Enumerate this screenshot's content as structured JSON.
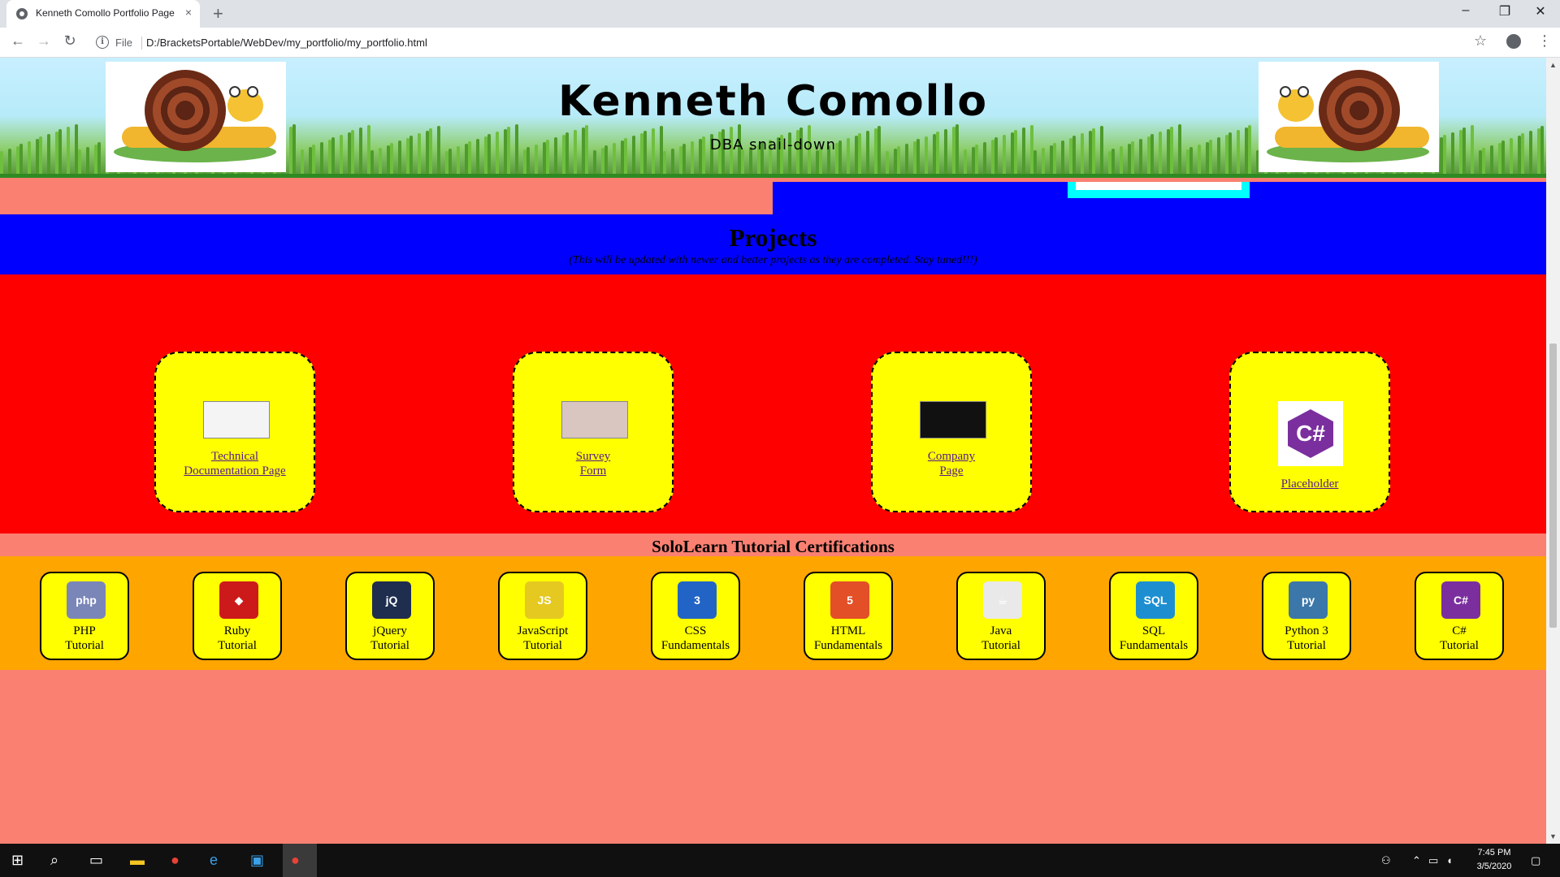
{
  "browser": {
    "tab_title": "Kenneth Comollo Portfolio Page",
    "new_tab": "+",
    "close_tab": "×",
    "minimize": "–",
    "restore": "❐",
    "close_window": "✕",
    "back": "←",
    "forward": "→",
    "reload": "↻",
    "info_icon": "i",
    "scheme_label": "File",
    "url": "D:/BracketsPortable/WebDev/my_portfolio/my_portfolio.html",
    "star": "☆",
    "menu": "⋮"
  },
  "header": {
    "name": "Kenneth Comollo",
    "tagline": "DBA snail-down"
  },
  "projects": {
    "title": "Projects",
    "subtitle": "(This will be updated with newer and better projects as they are completed. Stay tuned!!!)",
    "items": [
      {
        "label": "Technical Documentation Page"
      },
      {
        "label": "Survey Form"
      },
      {
        "label": "Company Page"
      },
      {
        "label": "Placeholder"
      }
    ]
  },
  "certifications": {
    "title": "SoloLearn Tutorial Certifications",
    "items": [
      {
        "line1": "PHP",
        "line2": "Tutorial",
        "logo_text": "php",
        "color": "#7a86b8"
      },
      {
        "line1": "Ruby",
        "line2": "Tutorial",
        "logo_text": "◆",
        "color": "#cc1a1a"
      },
      {
        "line1": "jQuery",
        "line2": "Tutorial",
        "logo_text": "jQ",
        "color": "#1f2d4f"
      },
      {
        "line1": "JavaScript",
        "line2": "Tutorial",
        "logo_text": "JS",
        "color": "#e5c920"
      },
      {
        "line1": "CSS",
        "line2": "Fundamentals",
        "logo_text": "3",
        "color": "#2264c6"
      },
      {
        "line1": "HTML",
        "line2": "Fundamentals",
        "logo_text": "5",
        "color": "#e34f26"
      },
      {
        "line1": "Java",
        "line2": "Tutorial",
        "logo_text": "☕",
        "color": "#e9e9e9"
      },
      {
        "line1": "SQL",
        "line2": "Fundamentals",
        "logo_text": "SQL",
        "color": "#1d8fd1"
      },
      {
        "line1": "Python 3",
        "line2": "Tutorial",
        "logo_text": "py",
        "color": "#3b77a8"
      },
      {
        "line1": "C#",
        "line2": "Tutorial",
        "logo_text": "C#",
        "color": "#7b2f9e"
      }
    ]
  },
  "placeholder_logo": "C#",
  "taskbar": {
    "time": "7:45 PM",
    "date": "3/5/2020"
  }
}
